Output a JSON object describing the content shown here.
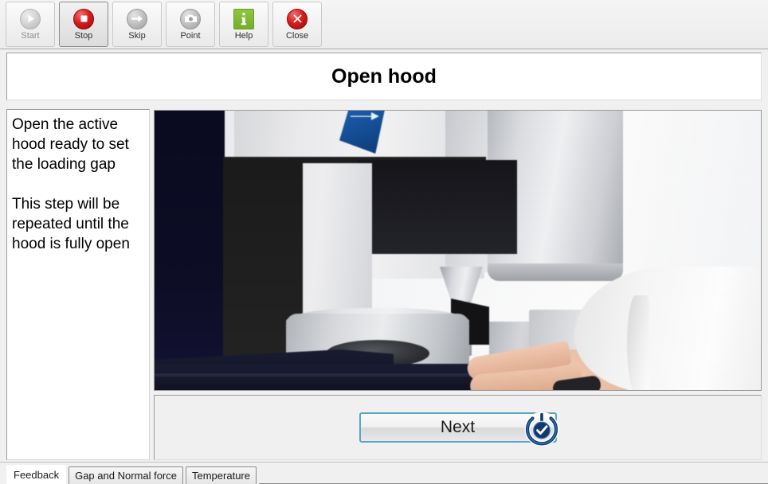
{
  "toolbar": {
    "buttons": [
      {
        "id": "start",
        "label": "Start",
        "icon": "play-icon",
        "state": "disabled"
      },
      {
        "id": "stop",
        "label": "Stop",
        "icon": "stop-icon",
        "state": "active"
      },
      {
        "id": "skip",
        "label": "Skip",
        "icon": "arrow-right-icon",
        "state": "normal"
      },
      {
        "id": "point",
        "label": "Point",
        "icon": "camera-icon",
        "state": "normal"
      },
      {
        "id": "help",
        "label": "Help",
        "icon": "info-icon",
        "state": "normal"
      },
      {
        "id": "close",
        "label": "Close",
        "icon": "close-circle-icon",
        "state": "normal"
      }
    ]
  },
  "header": {
    "title": "Open hood"
  },
  "instructions": {
    "text": "Open the active hood ready to set the loading gap\n\nThis step will be repeated until the hood is fully open"
  },
  "photo": {
    "alt": "Hands opening the active hood of a rheometer instrument"
  },
  "footer": {
    "next_label": "Next",
    "next_icon": "check-circle-icon"
  },
  "tabs": [
    {
      "label": "Feedback",
      "selected": true
    },
    {
      "label": "Gap and Normal force",
      "selected": false
    },
    {
      "label": "Temperature",
      "selected": false
    }
  ],
  "colors": {
    "accent_blue": "#5aa6c8",
    "icon_navy": "#123a6b",
    "stop_red": "#d81d1d",
    "help_green": "#8dc63f",
    "window_bg": "#f0f0f0"
  }
}
